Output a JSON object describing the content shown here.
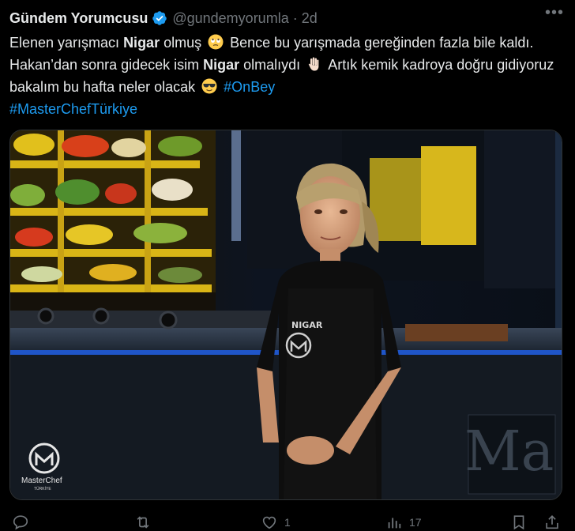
{
  "author": {
    "display_name": "Gündem Yorumcusu",
    "handle": "@gundemyorumla",
    "separator": "·",
    "time": "2d"
  },
  "tweet": {
    "seg1": "Elenen yarışmacı ",
    "name1": "Nigar",
    "seg2": " olmuş ",
    "seg3": " Bence bu yarışmada gereğinden fazla bile kaldı. Hakan’dan sonra gidecek isim ",
    "name2": "Nigar",
    "seg4": " olmalıydı ",
    "seg5": " Artık kemik kadroya doğru gidiyoruz bakalım bu hafta neler olacak ",
    "hashtag1": "#OnBey",
    "hashtag2": "#MasterChefTürkiye"
  },
  "emojis": [
    "rolling-eyes-emoji",
    "raised-hand-emoji",
    "sunglasses-emoji"
  ],
  "media": {
    "apron_name": "NIGAR",
    "logo_text": "MasterChef",
    "logo_sub": "TÜRKİYE",
    "bg_text": "Ma"
  },
  "actions": {
    "reply_count": "",
    "retweet_count": "",
    "like_count": "1",
    "views_count": "17"
  },
  "colors": {
    "background": "#000000",
    "text": "#e7e9ea",
    "secondary": "#71767b",
    "accent": "#1d9bf0"
  }
}
